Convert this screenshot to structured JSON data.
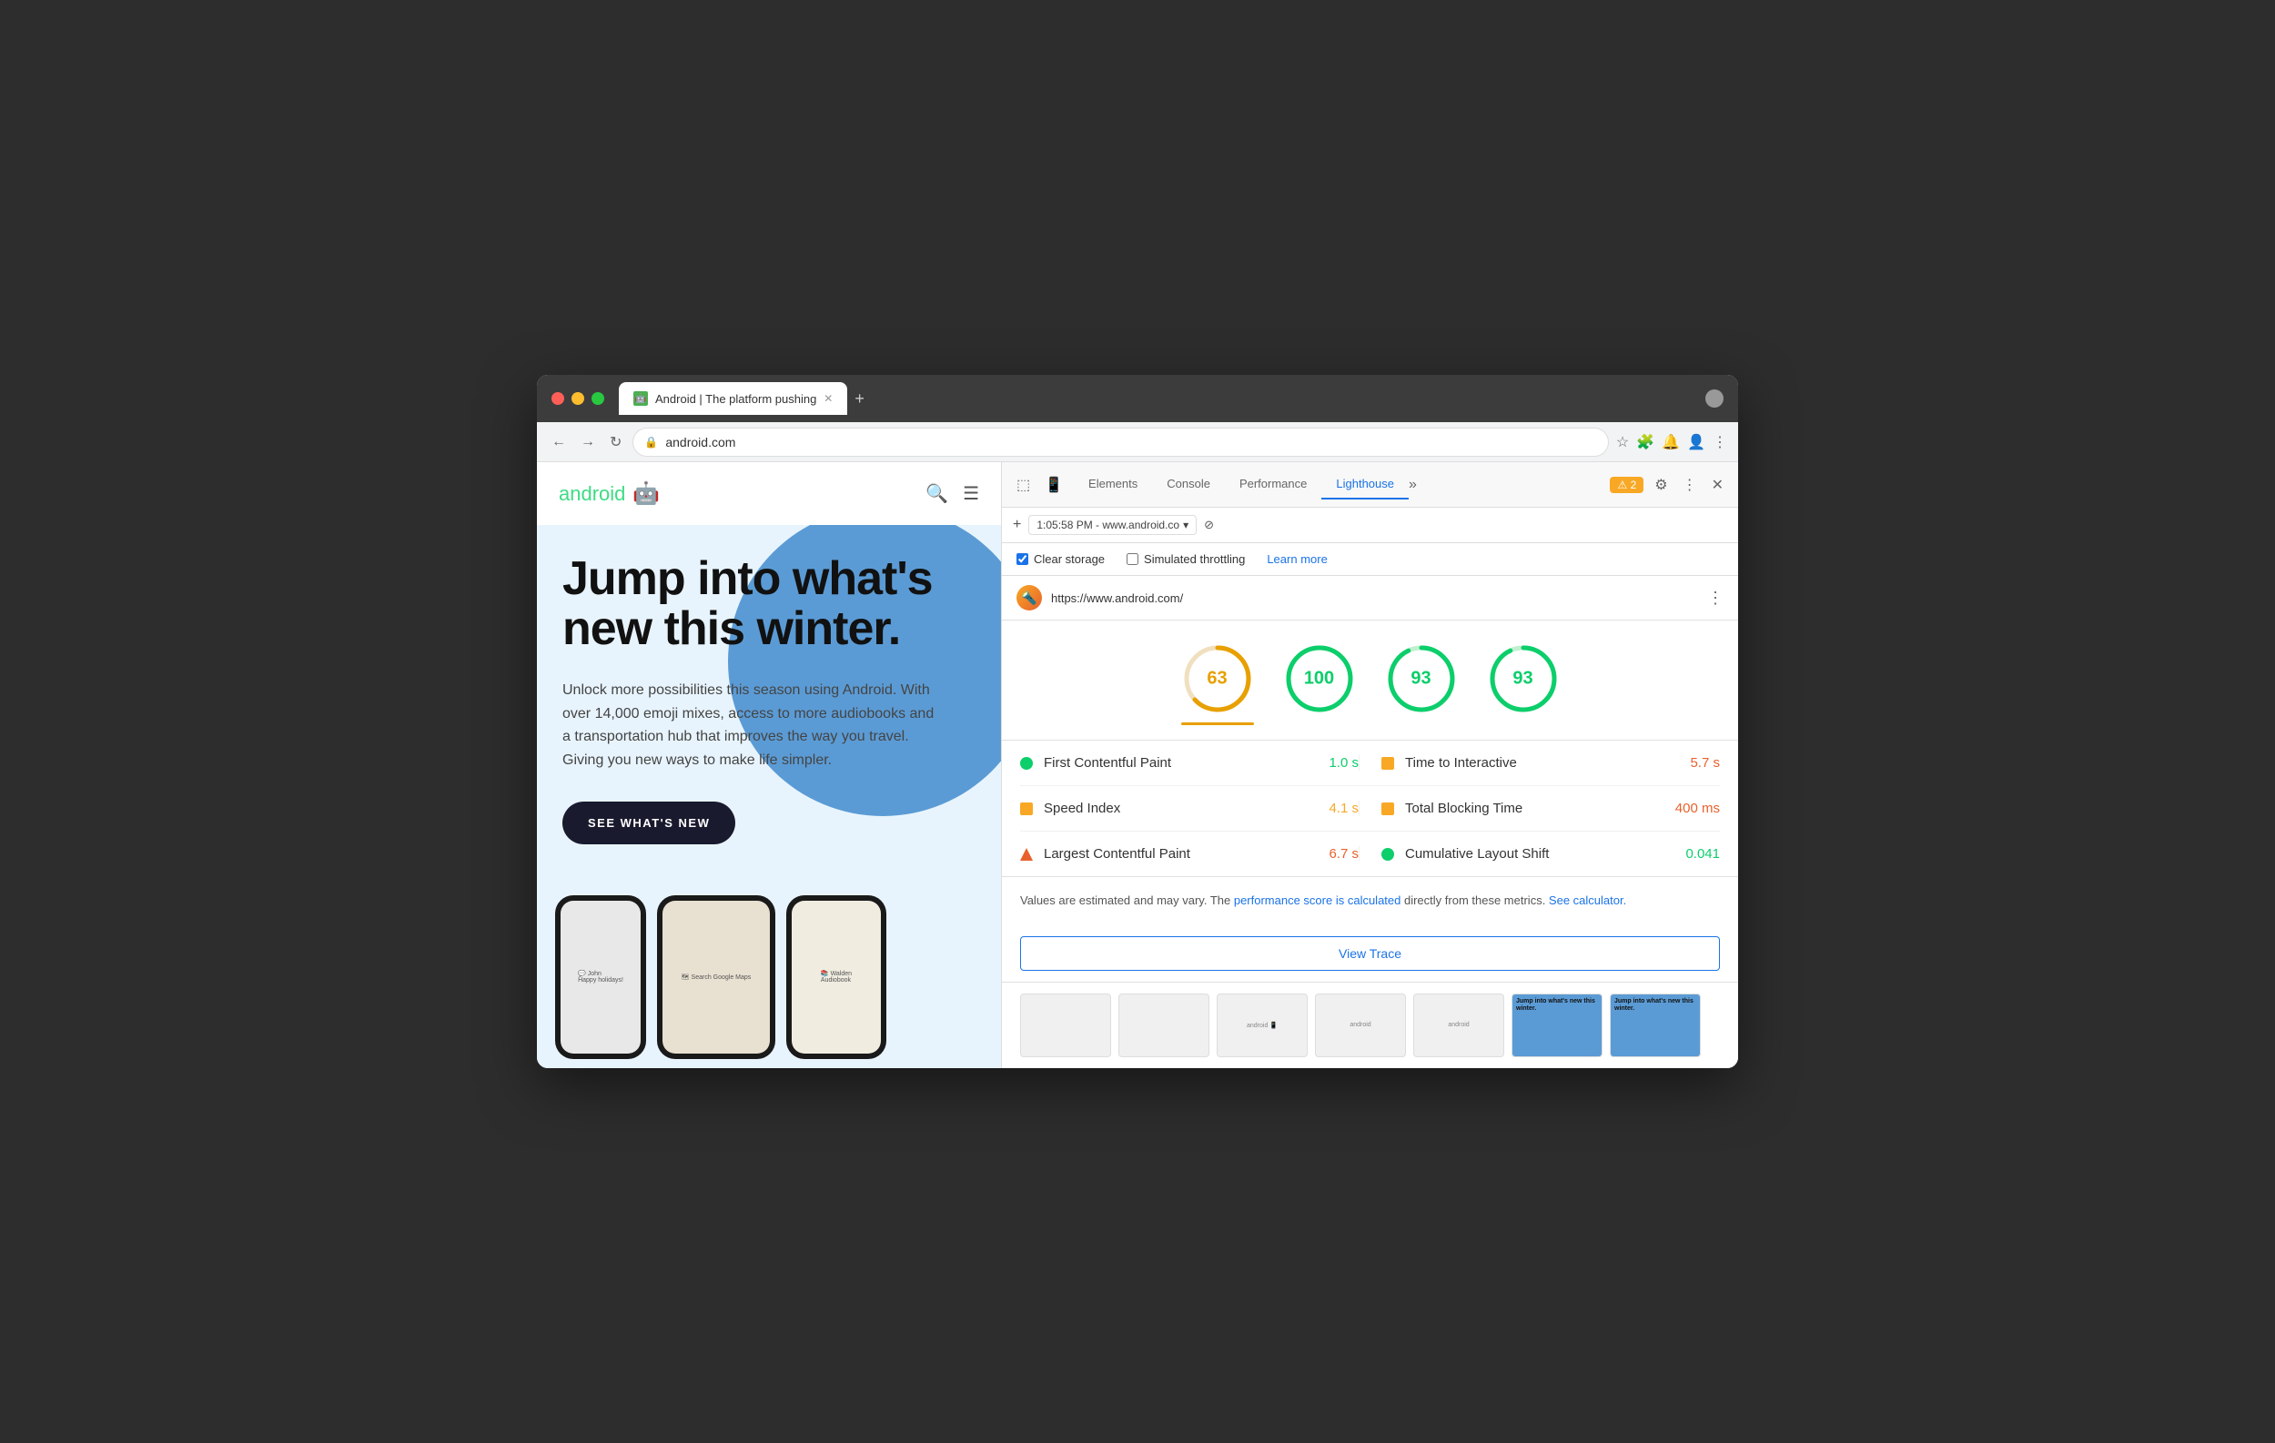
{
  "browser": {
    "tab_title": "Android | The platform pushing",
    "tab_favicon": "🤖",
    "url": "android.com",
    "full_url": "https://www.android.com/",
    "new_tab_label": "+",
    "nav_back": "←",
    "nav_forward": "→",
    "nav_refresh": "↻"
  },
  "android_page": {
    "logo_text": "android",
    "hero_title": "Jump into what's new this winter.",
    "hero_description": "Unlock more possibilities this season using Android. With over 14,000 emoji mixes, access to more audiobooks and a transportation hub that improves the way you travel. Giving you new ways to make life simpler.",
    "cta_button": "SEE WHAT'S NEW"
  },
  "devtools": {
    "tabs": [
      "Elements",
      "Console",
      "Performance",
      "Lighthouse"
    ],
    "active_tab": "Lighthouse",
    "more_tabs": "»",
    "warning_count": "⚠ 2",
    "gear_icon": "⚙",
    "menu_icon": "⋮",
    "close_icon": "✕",
    "session_bar": {
      "add": "+",
      "timestamp": "1:05:58 PM - www.android.co",
      "dropdown": "▾",
      "block_icon": "⊘"
    },
    "options_bar": {
      "clear_storage_label": "Clear storage",
      "clear_storage_checked": true,
      "simulated_throttling_label": "Simulated throttling",
      "simulated_throttling_checked": false,
      "learn_more_label": "Learn more"
    },
    "lighthouse_url": "https://www.android.com/",
    "lighthouse_icon": "🔦",
    "url_options": "⋮"
  },
  "scores": [
    {
      "id": "performance",
      "value": 63,
      "color": "orange"
    },
    {
      "id": "score2",
      "value": 100,
      "color": "green"
    },
    {
      "id": "score3",
      "value": 93,
      "color": "green"
    },
    {
      "id": "score4",
      "value": 93,
      "color": "green"
    }
  ],
  "metrics": [
    {
      "left": {
        "indicator": "green-circle",
        "name": "First Contentful Paint",
        "value": "1.0 s",
        "value_class": "val-green"
      },
      "right": {
        "indicator": "orange-square",
        "name": "Time to Interactive",
        "value": "5.7 s",
        "value_class": "val-red"
      }
    },
    {
      "left": {
        "indicator": "orange-square",
        "name": "Speed Index",
        "value": "4.1 s",
        "value_class": "val-orange"
      },
      "right": {
        "indicator": "orange-square",
        "name": "Total Blocking Time",
        "value": "400 ms",
        "value_class": "val-red"
      }
    },
    {
      "left": {
        "indicator": "red-triangle",
        "name": "Largest Contentful Paint",
        "value": "6.7 s",
        "value_class": "val-red"
      },
      "right": {
        "indicator": "green-circle",
        "name": "Cumulative Layout Shift",
        "value": "0.041",
        "value_class": "val-green"
      }
    }
  ],
  "info_text": {
    "prefix": "Values are estimated and may vary. The ",
    "link1_text": "performance score is calculated",
    "link1_href": "#",
    "middle": " directly from these metrics. ",
    "link2_text": "See calculator.",
    "link2_href": "#"
  },
  "view_trace_button": "View Trace"
}
